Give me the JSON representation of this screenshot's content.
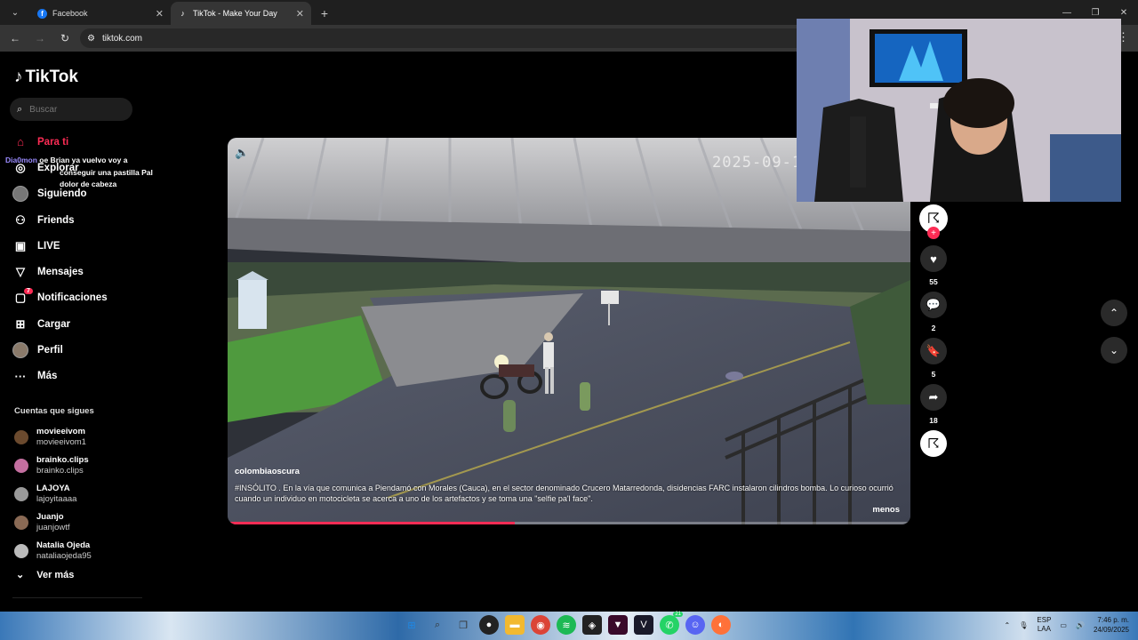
{
  "browser": {
    "tabs": [
      {
        "title": "Facebook",
        "favicon": "f"
      },
      {
        "title": "TikTok - Make Your Day",
        "favicon": "♪"
      }
    ],
    "url": "tiktok.com"
  },
  "sidebar": {
    "logo": "TikTok",
    "search_placeholder": "Buscar",
    "items": [
      {
        "label": "Para ti",
        "icon": "home-icon"
      },
      {
        "label": "Explorar",
        "icon": "compass-icon"
      },
      {
        "label": "Siguiendo",
        "icon": "following-icon"
      },
      {
        "label": "Friends",
        "icon": "friends-icon"
      },
      {
        "label": "LIVE",
        "icon": "live-icon"
      },
      {
        "label": "Mensajes",
        "icon": "message-icon"
      },
      {
        "label": "Notificaciones",
        "icon": "notification-icon",
        "badge": "7"
      },
      {
        "label": "Cargar",
        "icon": "upload-icon"
      },
      {
        "label": "Perfil",
        "icon": "profile-icon"
      },
      {
        "label": "Más",
        "icon": "more-icon"
      }
    ],
    "following_title": "Cuentas que sigues",
    "following": [
      {
        "name": "movieeivom",
        "handle": "movieeivom1"
      },
      {
        "name": "brainko.clips",
        "handle": "brainko.clips"
      },
      {
        "name": "LAJOYA",
        "handle": "lajoyitaaaa"
      },
      {
        "name": "Juanjo",
        "handle": "juanjowtf"
      },
      {
        "name": "Natalia Ojeda",
        "handle": "nataliaojeda95"
      }
    ],
    "see_more": "Ver más"
  },
  "chat_overlay": {
    "user": "Dia0mon",
    "line1": "oe Brian ya vuelvo voy a",
    "line2": "conseguir una pastilla Pal",
    "line3": "dolor de cabeza"
  },
  "video": {
    "timestamp": "2025-09-1",
    "author": "colombiaoscura",
    "caption": "#INSÓLITO . En la vía que comunica a Piendamó con Morales (Cauca), en el sector denominado Crucero Matarredonda, disidencias FARC instalaron cilindros bomba. Lo curioso ocurrió cuando un individuo en motocicleta se acerca a uno de los artefactos y se toma una \"selfie pa'l face\".",
    "less_label": "menos",
    "progress": 0.42
  },
  "actions": {
    "likes": "55",
    "comments": "2",
    "saves": "5",
    "shares": "18"
  },
  "taskbar": {
    "lang_line1": "ESP",
    "lang_line2": "LAA",
    "time": "7:46 p. m.",
    "date": "24/09/2025",
    "badge_count": "21"
  },
  "colors": {
    "accent": "#fe2c55",
    "sidebar_bg": "#000000"
  }
}
